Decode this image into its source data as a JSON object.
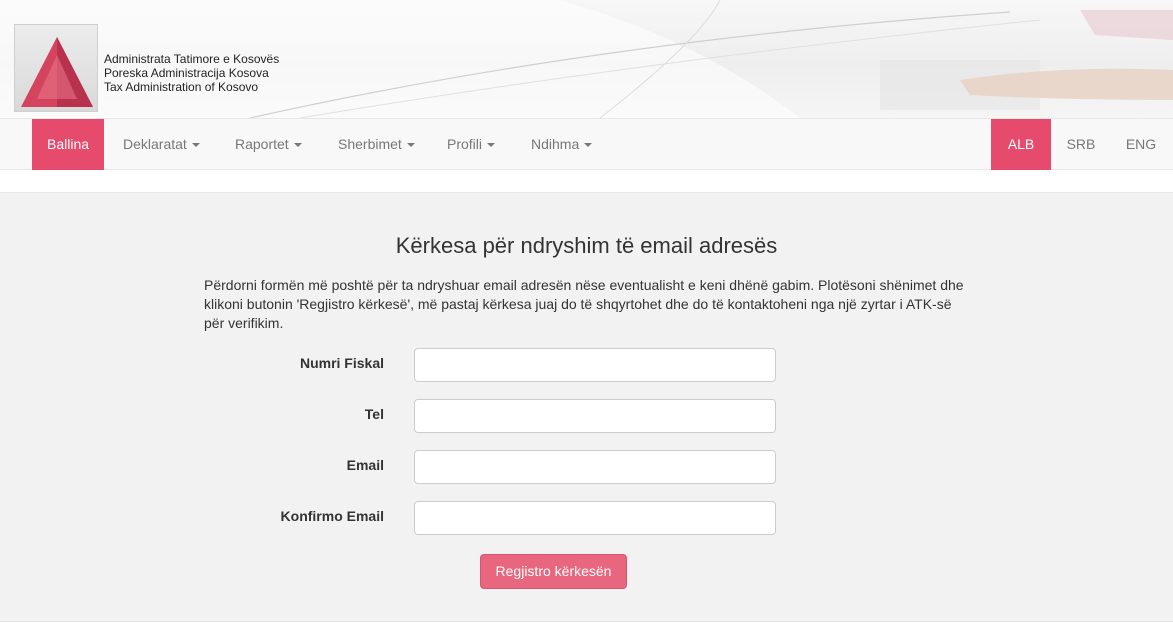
{
  "header": {
    "org_names": [
      "Administrata Tatimore e Kosovës",
      "Poreska Administracija Kosova",
      "Tax Administration of Kosovo"
    ],
    "logo": "atk-triangle-logo"
  },
  "nav": {
    "items": [
      {
        "label": "Ballina",
        "active": true,
        "dropdown": false
      },
      {
        "label": "Deklaratat",
        "active": false,
        "dropdown": true
      },
      {
        "label": "Raportet",
        "active": false,
        "dropdown": true
      },
      {
        "label": "Sherbimet",
        "active": false,
        "dropdown": true
      },
      {
        "label": "Profili",
        "active": false,
        "dropdown": true
      },
      {
        "label": "Ndihma",
        "active": false,
        "dropdown": true
      }
    ],
    "languages": [
      {
        "label": "ALB",
        "active": true
      },
      {
        "label": "SRB",
        "active": false
      },
      {
        "label": "ENG",
        "active": false
      }
    ]
  },
  "form": {
    "title": "Kërkesa për ndryshim të email adresës",
    "intro": "Përdorni formën më poshtë për ta ndryshuar email adresën nëse eventualisht e keni dhënë gabim. Plotësoni shënimet dhe klikoni butonin 'Regjistro kërkesë', më pastaj kërkesa juaj do të shqyrtohet dhe do të kontaktoheni nga një zyrtar i ATK-së për verifikim.",
    "fields": [
      {
        "label": "Numri Fiskal",
        "value": ""
      },
      {
        "label": "Tel",
        "value": ""
      },
      {
        "label": "Email",
        "value": ""
      },
      {
        "label": "Konfirmo Email",
        "value": ""
      }
    ],
    "submit_label": "Regjistro kërkesën"
  },
  "colors": {
    "accent": "#e64b6d",
    "button": "#e8677f",
    "panel_bg": "#f2f2f2",
    "navbar_bg": "#f8f8f8"
  }
}
